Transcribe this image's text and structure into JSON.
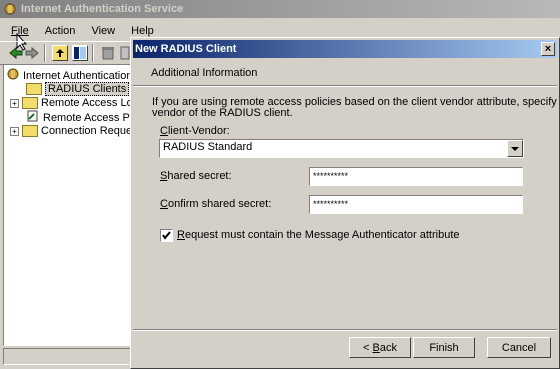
{
  "app": {
    "title": "Internet Authentication Service",
    "menu": [
      "File",
      "Action",
      "View",
      "Help"
    ]
  },
  "tree": {
    "root": "Internet Authentication S",
    "items": [
      "RADIUS Clients",
      "Remote Access Loggi",
      "Remote Access Policie",
      "Connection Request P"
    ]
  },
  "dialog": {
    "title": "New RADIUS Client",
    "section_title": "Additional Information",
    "description_line1": "If you are using remote access policies based on the client vendor attribute, specify the",
    "description_line2": "vendor of the RADIUS client.",
    "client_vendor_label_pre": "",
    "client_vendor_label_u": "C",
    "client_vendor_label_post": "lient-Vendor:",
    "client_vendor_value": "RADIUS Standard",
    "shared_secret_label_pre": "",
    "shared_secret_label_u": "S",
    "shared_secret_label_post": "hared secret:",
    "shared_secret_value": "**********",
    "confirm_label_pre": "",
    "confirm_label_u": "C",
    "confirm_label_post": "onfirm shared secret:",
    "confirm_value": "**********",
    "checkbox_label_pre": "",
    "checkbox_label_u": "R",
    "checkbox_label_post": "equest must contain the Message Authenticator attribute",
    "checkbox_checked": true,
    "back_pre": "< ",
    "back_u": "B",
    "back_post": "ack",
    "finish": "Finish",
    "cancel": "Cancel"
  }
}
